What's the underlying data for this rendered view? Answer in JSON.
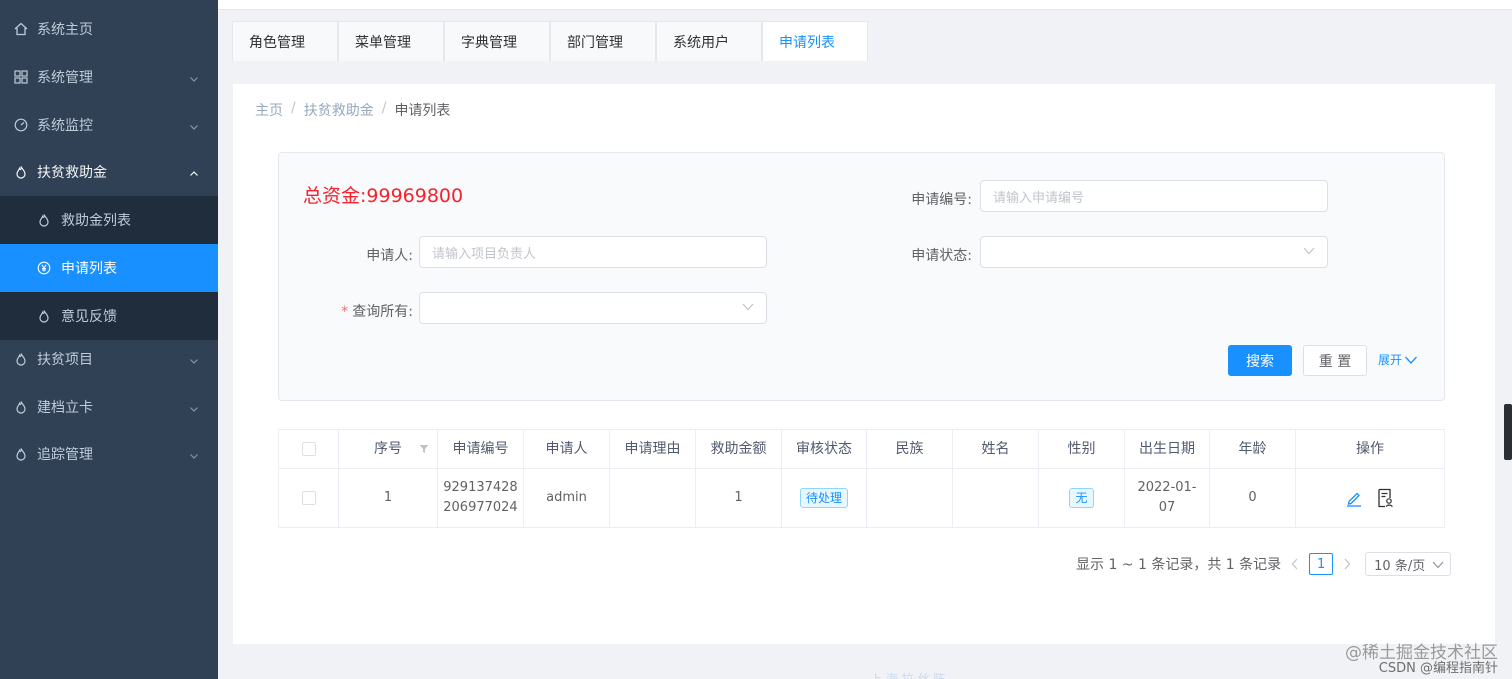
{
  "sidebar": {
    "items": [
      {
        "label": "系统主页",
        "icon": "home-icon"
      },
      {
        "label": "系统管理",
        "icon": "grid-icon"
      },
      {
        "label": "系统监控",
        "icon": "dashboard-icon"
      },
      {
        "label": "扶贫救助金",
        "icon": "drop-icon"
      },
      {
        "label": "救助金列表",
        "icon": "drop-icon"
      },
      {
        "label": "申请列表",
        "icon": "yen-icon"
      },
      {
        "label": "意见反馈",
        "icon": "drop-icon"
      },
      {
        "label": "扶贫项目",
        "icon": "drop-icon"
      },
      {
        "label": "建档立卡",
        "icon": "drop-icon"
      },
      {
        "label": "追踪管理",
        "icon": "drop-icon"
      }
    ]
  },
  "tabs": [
    "角色管理",
    "菜单管理",
    "字典管理",
    "部门管理",
    "系统用户",
    "申请列表"
  ],
  "breadcrumb": {
    "home": "主页",
    "sep": "/",
    "parent": "扶贫救助金",
    "current": "申请列表"
  },
  "search": {
    "total_label": "总资金:99969800",
    "apply_no_label": "申请编号:",
    "apply_no_placeholder": "请输入申请编号",
    "applicant_label": "申请人:",
    "applicant_placeholder": "请输入项目负责人",
    "status_label": "申请状态:",
    "query_all_label": "查询所有:",
    "search_btn": "搜索",
    "reset_btn": "重 置",
    "expand": "展开"
  },
  "table": {
    "headers": [
      "序号",
      "申请编号",
      "申请人",
      "申请理由",
      "救助金额",
      "审核状态",
      "民族",
      "姓名",
      "性别",
      "出生日期",
      "年龄",
      "操作"
    ],
    "row": {
      "index": "1",
      "apply_no_1": "929137428",
      "apply_no_2": "206977024",
      "applicant": "admin",
      "reason": "",
      "amount": "1",
      "status": "待处理",
      "nation": "",
      "name": "",
      "gender": "无",
      "birth_1": "2022-01-",
      "birth_2": "07",
      "age": "0"
    }
  },
  "pagination": {
    "summary": "显示 1 ~ 1 条记录，共 1 条记录",
    "page": "1",
    "page_size": "10 条/页"
  },
  "footer_faint": "上 海 拉 丝 阵",
  "watermark": {
    "line1": "@稀土掘金技术社区",
    "line2": "CSDN @编程指南针"
  },
  "colors": {
    "sidebar_bg": "#304156",
    "active": "#1890ff",
    "danger": "#f5222d"
  }
}
